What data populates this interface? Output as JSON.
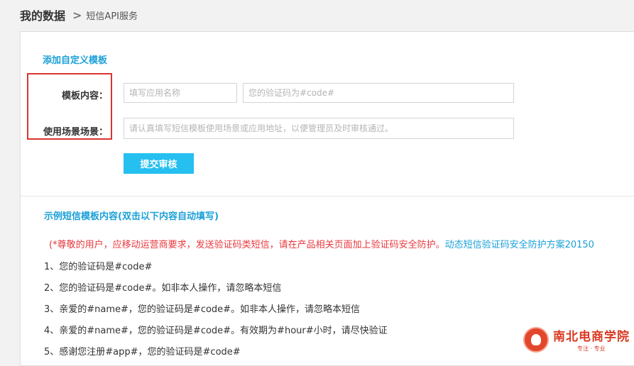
{
  "breadcrumb": {
    "title": "我的数据",
    "separator": ">",
    "current": "短信API服务"
  },
  "form": {
    "section_title": "添加自定义模板",
    "template_label": "模板内容：",
    "app_name_placeholder": "填写应用名称",
    "content_placeholder": "您的验证码为#code#",
    "scenario_label": "使用场景场景：",
    "scenario_placeholder": "请认真填写短信模板使用场景或应用地址，以便管理员及时审核通过。",
    "submit_label": "提交审核"
  },
  "examples": {
    "title": "示例短信模板内容(双击以下内容自动填写)",
    "notice_red": "(*尊敬的用户，应移动运营商要求，发送验证码类短信，请在产品相关页面加上验证码安全防护。",
    "notice_link": "动态短信验证码安全防护方案20150",
    "items": [
      "1、您的验证码是#code#",
      "2、您的验证码是#code#。如非本人操作，请忽略本短信",
      "3、亲爱的#name#，您的验证码是#code#。如非本人操作，请忽略本短信",
      "4、亲爱的#name#，您的验证码是#code#。有效期为#hour#小时，请尽快验证",
      "5、感谢您注册#app#，您的验证码是#code#"
    ]
  },
  "watermark": {
    "name": "南北电商学院",
    "slogan": "专注 · 专业"
  },
  "colors": {
    "accent": "#1aa0d8",
    "button": "#25bff0",
    "highlight_border": "#d9352f",
    "notice_red": "#e8383d"
  }
}
